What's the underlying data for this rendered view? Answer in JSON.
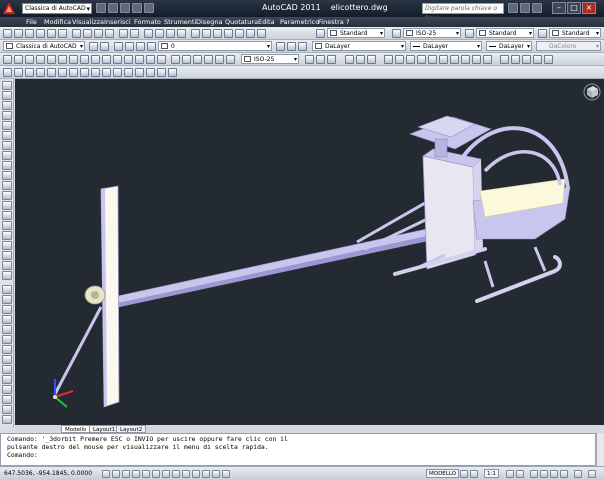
{
  "app": {
    "title": "AutoCAD 2011",
    "document": "elicottero.dwg",
    "workspace": "Classica di AutoCAD",
    "search_placeholder": "Digitare parola chiave o frase"
  },
  "menu": [
    "File",
    "Modifica",
    "Visualizza",
    "Inserisci",
    "Formato",
    "Strumenti",
    "Disegna",
    "Quotatura",
    "Edita",
    "Parametrico",
    "Finestra",
    "?"
  ],
  "toolbar1": {
    "text_style": "Standard",
    "dim_style": "ISO-25",
    "table_style": "Standard",
    "multileader_style": "Standard"
  },
  "toolbar2": {
    "workspace": "Classica di AutoCAD",
    "layer": "0",
    "color": "DaLayer",
    "linetype": "DaLayer",
    "lineweight": "DaLayer",
    "plotstyle": "DaColore"
  },
  "toolbar3": {
    "dim_style": "ISO-25"
  },
  "tabs": [
    "Modello",
    "Layout1",
    "Layout2"
  ],
  "command": {
    "line1": "Comando: '_3dorbit Premere ESC o INVIO per uscire oppure fare clic con il",
    "line2": "pulsante destro del mouse per visualizzare il menu di scelta rapida.",
    "prompt": "Comando:"
  },
  "status": {
    "coords": "647.5036, -954.1845, 0.0000",
    "model": "MODELLO",
    "scale": "1:1"
  },
  "colors": {
    "viewport_bg": "#242a31",
    "model_fill": "#c9c6ee",
    "model_accent": "#fbf8dc",
    "ucs_x": "#e03030",
    "ucs_y": "#30c030",
    "ucs_z": "#3050ff"
  },
  "icons": [
    "autocad-logo-icon",
    "viewcube-icon",
    "ucs-icon"
  ]
}
